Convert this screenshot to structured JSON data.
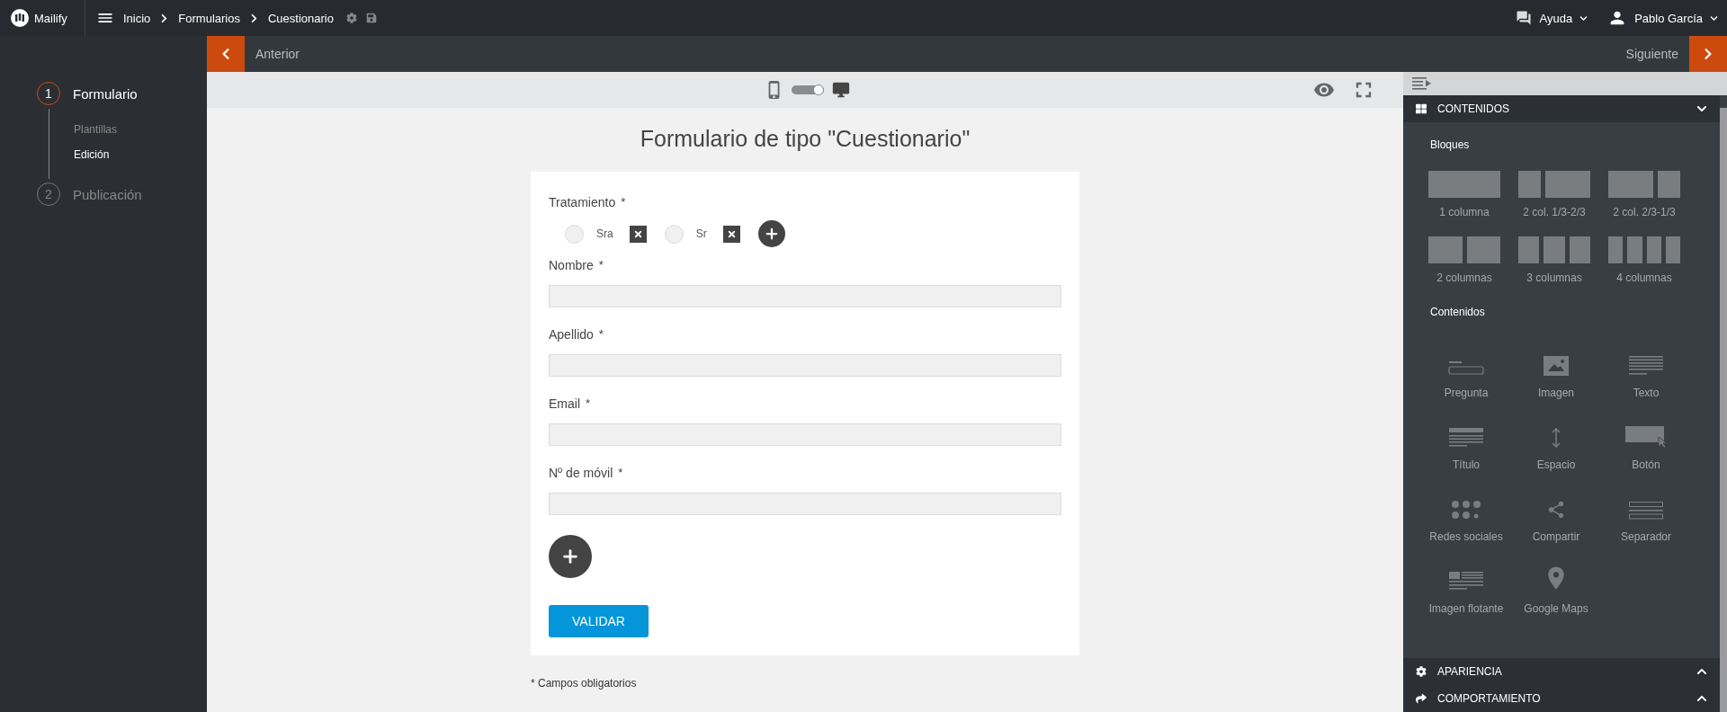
{
  "topbar": {
    "brand": "Mailify",
    "breadcrumb": [
      "Inicio",
      "Formularios",
      "Cuestionario"
    ],
    "help": "Ayuda",
    "user": "Pablo García"
  },
  "nav": {
    "previous": "Anterior",
    "next": "Siguiente"
  },
  "steps": [
    {
      "number": "1",
      "label": "Formulario",
      "selected": true,
      "children": [
        {
          "label": "Plantillas",
          "selected": false
        },
        {
          "label": "Edición",
          "selected": true
        }
      ]
    },
    {
      "number": "2",
      "label": "Publicación",
      "selected": false
    }
  ],
  "preview": {
    "devices": [
      {
        "kind": "mobile",
        "selected": false
      },
      {
        "kind": "desktop",
        "selected": true
      }
    ]
  },
  "form": {
    "title": "Formulario de tipo \"Cuestionario\"",
    "fields": [
      {
        "kind": "radio",
        "label": "Tratamiento",
        "mark": "*",
        "options": [
          {
            "label": "Sra",
            "selected": false
          },
          {
            "label": "Sr",
            "selected": false
          }
        ]
      },
      {
        "kind": "text",
        "label": "Nombre",
        "mark": "*"
      },
      {
        "kind": "text",
        "label": "Apellido",
        "mark": "*"
      },
      {
        "kind": "text",
        "label": "Email",
        "mark": "*"
      },
      {
        "kind": "text",
        "label": "Nº de móvil",
        "mark": "*"
      }
    ],
    "submit": "VALIDAR",
    "footnote": "* Campos obligatorios"
  },
  "panel": {
    "sections": [
      {
        "kind": "grid",
        "title": "CONTENIDOS",
        "expanded": true,
        "groups": [
          {
            "title": "Bloques",
            "kind": "blocks",
            "items": [
              {
                "kind": "one",
                "label": "1 columna"
              },
              {
                "kind": "thirdwide",
                "label": "2 col. 1/3-2/3"
              },
              {
                "kind": "widethird",
                "label": "2 col. 2/3-1/3"
              },
              {
                "kind": "two",
                "label": "2 columnas"
              },
              {
                "kind": "three",
                "label": "3 columnas"
              },
              {
                "kind": "four",
                "label": "4 columnas"
              }
            ]
          },
          {
            "title": "Contenidos",
            "kind": "contents",
            "items": [
              {
                "kind": "question",
                "label": "Pregunta"
              },
              {
                "kind": "image",
                "label": "Imagen"
              },
              {
                "kind": "text",
                "label": "Texto"
              },
              {
                "kind": "title",
                "label": "Título"
              },
              {
                "kind": "space",
                "label": "Espacio"
              },
              {
                "kind": "button",
                "label": "Botón"
              },
              {
                "kind": "social",
                "label": "Redes sociales"
              },
              {
                "kind": "share",
                "label": "Compartir"
              },
              {
                "kind": "separator",
                "label": "Separador"
              },
              {
                "kind": "floating",
                "label": "Imagen flotante"
              },
              {
                "kind": "map",
                "label": "Google Maps"
              }
            ]
          }
        ]
      },
      {
        "kind": "gear",
        "title": "APARIENCIA",
        "expanded": false
      },
      {
        "kind": "share",
        "title": "COMPORTAMIENTO",
        "expanded": false
      }
    ]
  }
}
